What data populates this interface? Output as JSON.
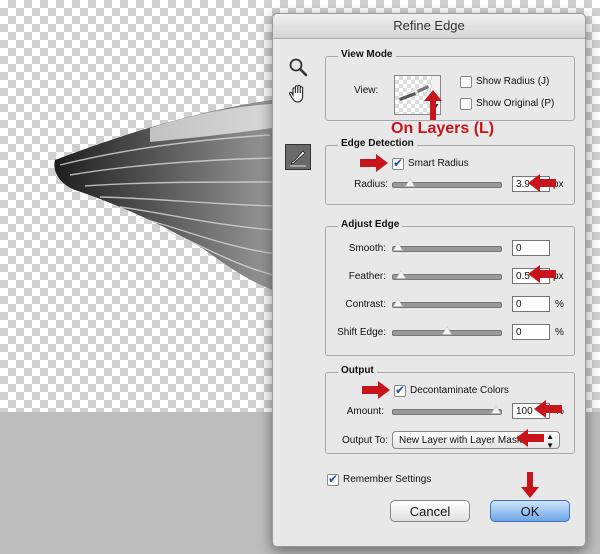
{
  "dialog": {
    "title": "Refine Edge"
  },
  "annotation": "On Layers (L)",
  "view_mode": {
    "title": "View Mode",
    "view_label": "View:",
    "show_radius": {
      "label": "Show Radius (J)",
      "checked": false
    },
    "show_original": {
      "label": "Show Original (P)",
      "checked": false
    }
  },
  "edge_detection": {
    "title": "Edge Detection",
    "smart_radius": {
      "label": "Smart Radius",
      "checked": true
    },
    "radius": {
      "label": "Radius:",
      "value": "3.9",
      "unit": "px",
      "level": 0.12
    }
  },
  "adjust_edge": {
    "title": "Adjust Edge",
    "smooth": {
      "label": "Smooth:",
      "value": "0",
      "level": 0.0
    },
    "feather": {
      "label": "Feather:",
      "value": "0.5",
      "unit": "px",
      "level": 0.03
    },
    "contrast": {
      "label": "Contrast:",
      "value": "0",
      "unit": "%",
      "level": 0.0
    },
    "shift_edge": {
      "label": "Shift Edge:",
      "value": "0",
      "unit": "%",
      "level": 0.5
    }
  },
  "output": {
    "title": "Output",
    "decontaminate": {
      "label": "Decontaminate Colors",
      "checked": true
    },
    "amount": {
      "label": "Amount:",
      "value": "100",
      "unit": "%",
      "level": 1.0
    },
    "output_to_label": "Output To:",
    "output_to_value": "New Layer with Layer Mask"
  },
  "remember_settings": {
    "label": "Remember Settings",
    "checked": true
  },
  "buttons": {
    "cancel": "Cancel",
    "ok": "OK"
  },
  "colors": {
    "arrow": "#c8151b",
    "ok_button": "#6fa5e6"
  },
  "icons": [
    "zoom-icon",
    "hand-icon",
    "refine-radius-brush-icon",
    "red-arrow-icon"
  ]
}
